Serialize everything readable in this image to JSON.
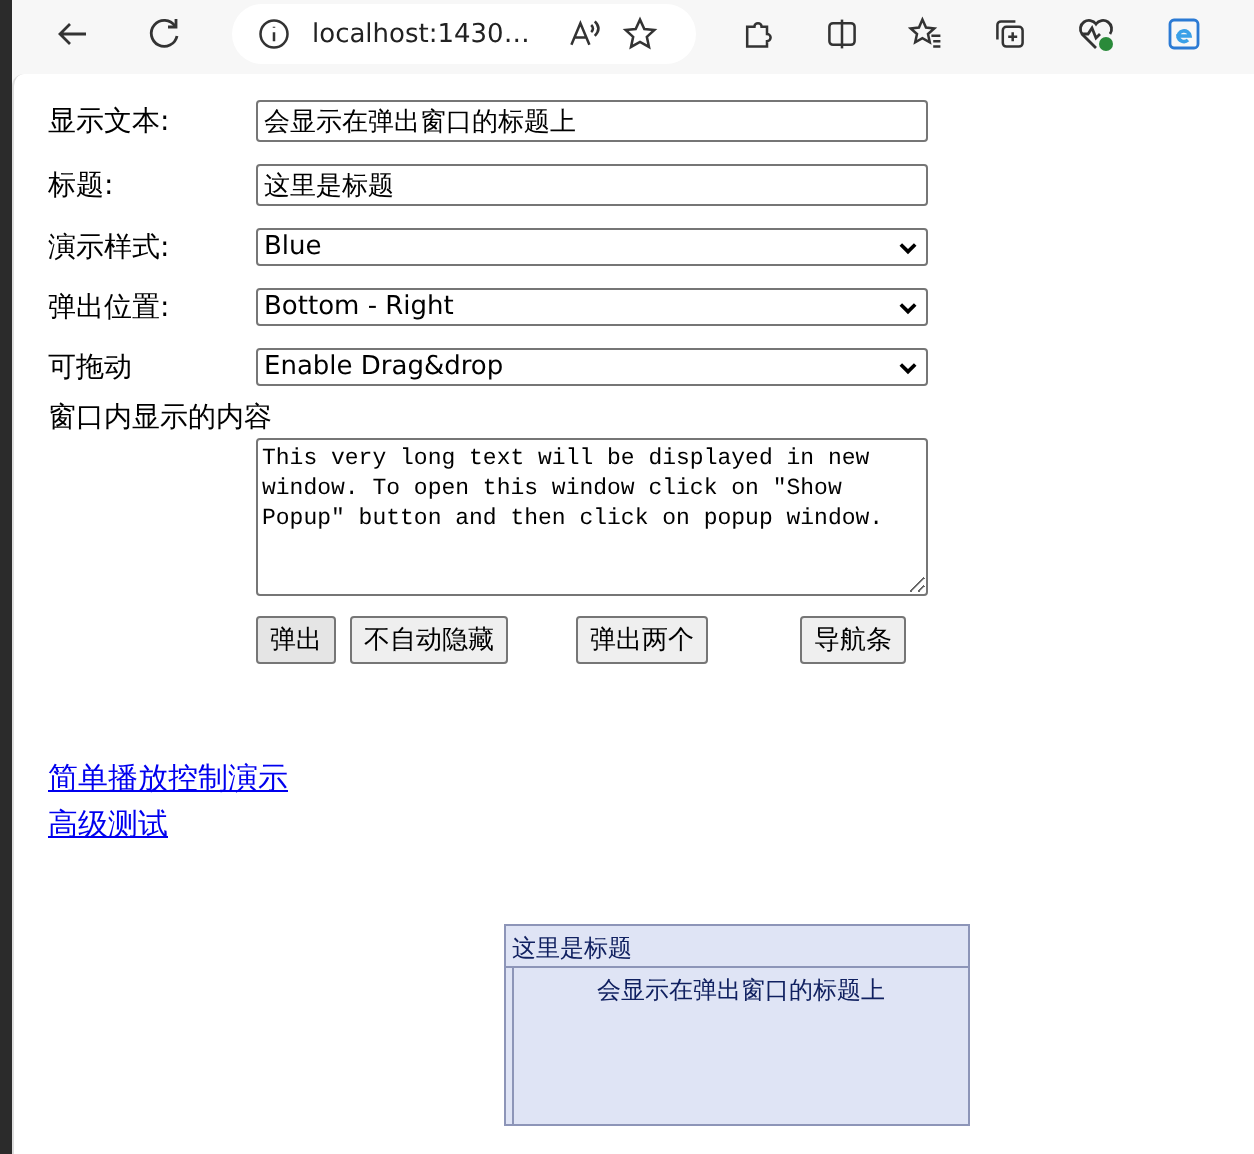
{
  "browser": {
    "address": "localhost:1430…"
  },
  "form": [
    {
      "kind": "text",
      "label": "显示文本:",
      "value": "会显示在弹出窗口的标题上"
    },
    {
      "kind": "text",
      "label": "标题:",
      "value": "这里是标题"
    },
    {
      "kind": "select",
      "label": "演示样式:",
      "value": "Blue"
    },
    {
      "kind": "select",
      "label": "弹出位置:",
      "value": "Bottom - Right"
    },
    {
      "kind": "select",
      "label": "可拖动",
      "value": "Enable Drag&drop"
    }
  ],
  "content_label": "窗口内显示的内容",
  "content_text": "This very long text will be displayed in new window. To open this window click on \"Show Popup\" button and then click on popup window.",
  "buttons": [
    "弹出",
    "不自动隐藏",
    "弹出两个",
    "导航条"
  ],
  "links": [
    "简单播放控制演示",
    "高级测试"
  ],
  "popup": {
    "title": "这里是标题",
    "body": "会显示在弹出窗口的标题上"
  }
}
